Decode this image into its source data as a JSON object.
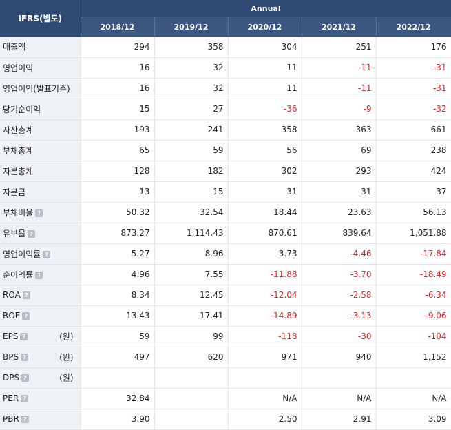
{
  "header": {
    "corner": "IFRS(별도)",
    "period_group": "Annual",
    "years": [
      "2018/12",
      "2019/12",
      "2020/12",
      "2021/12",
      "2022/12"
    ]
  },
  "help_icon": "?",
  "rows": [
    {
      "label": "매출액",
      "values": [
        "294",
        "358",
        "304",
        "251",
        "176"
      ]
    },
    {
      "label": "영업이익",
      "values": [
        "16",
        "32",
        "11",
        "-11",
        "-31"
      ]
    },
    {
      "label": "영업이익(발표기준)",
      "values": [
        "16",
        "32",
        "11",
        "-11",
        "-31"
      ]
    },
    {
      "label": "당기순이익",
      "values": [
        "15",
        "27",
        "-36",
        "-9",
        "-32"
      ]
    },
    {
      "label": "자산총계",
      "values": [
        "193",
        "241",
        "358",
        "363",
        "661"
      ]
    },
    {
      "label": "부채총계",
      "values": [
        "65",
        "59",
        "56",
        "69",
        "238"
      ]
    },
    {
      "label": "자본총계",
      "values": [
        "128",
        "182",
        "302",
        "293",
        "424"
      ]
    },
    {
      "label": "자본금",
      "values": [
        "13",
        "15",
        "31",
        "31",
        "37"
      ]
    },
    {
      "label": "부채비율",
      "help": true,
      "values": [
        "50.32",
        "32.54",
        "18.44",
        "23.63",
        "56.13"
      ]
    },
    {
      "label": "유보율",
      "help": true,
      "values": [
        "873.27",
        "1,114.43",
        "870.61",
        "839.64",
        "1,051.88"
      ]
    },
    {
      "label": "영업이익률",
      "help": true,
      "values": [
        "5.27",
        "8.96",
        "3.73",
        "-4.46",
        "-17.84"
      ]
    },
    {
      "label": "순이익률",
      "help": true,
      "values": [
        "4.96",
        "7.55",
        "-11.88",
        "-3.70",
        "-18.49"
      ]
    },
    {
      "label": "ROA",
      "help": true,
      "values": [
        "8.34",
        "12.45",
        "-12.04",
        "-2.58",
        "-6.34"
      ]
    },
    {
      "label": "ROE",
      "help": true,
      "values": [
        "13.43",
        "17.41",
        "-14.89",
        "-3.13",
        "-9.06"
      ]
    },
    {
      "label": "EPS",
      "help": true,
      "unit": "(원)",
      "values": [
        "59",
        "99",
        "-118",
        "-30",
        "-104"
      ]
    },
    {
      "label": "BPS",
      "help": true,
      "unit": "(원)",
      "values": [
        "497",
        "620",
        "971",
        "940",
        "1,152"
      ]
    },
    {
      "label": "DPS",
      "help": true,
      "unit": "(원)",
      "values": [
        "",
        "",
        "",
        "",
        ""
      ]
    },
    {
      "label": "PER",
      "help": true,
      "values": [
        "32.84",
        "",
        "N/A",
        "N/A",
        "N/A"
      ]
    },
    {
      "label": "PBR",
      "help": true,
      "values": [
        "3.90",
        "",
        "2.50",
        "2.91",
        "3.09"
      ]
    }
  ]
}
